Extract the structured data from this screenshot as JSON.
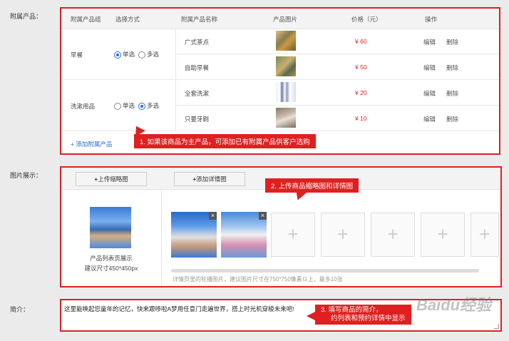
{
  "labels": {
    "accessory": "附属产品：",
    "images": "图片展示：",
    "intro": "简介："
  },
  "accessory_table": {
    "headers": [
      "附属产品组",
      "选择方式",
      "附属产品名称",
      "产品图片",
      "价格（元）",
      "操作"
    ],
    "groups": [
      {
        "name": "早餐",
        "options": [
          {
            "label": "单选",
            "selected": true
          },
          {
            "label": "多选",
            "selected": false
          }
        ],
        "items": [
          {
            "name": "广式茶点",
            "price": "¥ 60",
            "edit": "编辑",
            "delete": "删除"
          },
          {
            "name": "自助早餐",
            "price": "¥ 50",
            "edit": "编辑",
            "delete": "删除"
          }
        ]
      },
      {
        "name": "洗漱用品",
        "options": [
          {
            "label": "单选",
            "selected": false
          },
          {
            "label": "多选",
            "selected": true
          }
        ],
        "items": [
          {
            "name": "全套洗漱",
            "price": "¥ 20",
            "edit": "编辑",
            "delete": "删除"
          },
          {
            "name": "只要牙刷",
            "price": "¥ 10",
            "edit": "编辑",
            "delete": "删除"
          }
        ]
      }
    ],
    "add_link": "+ 添加附属产品"
  },
  "callouts": {
    "c1": "1. 如果该商品为主产品，可添加已有附属产品供客户选购",
    "c2": "2. 上传商品缩略图和详情图",
    "c3_line1": "3. 填写商品的简介，",
    "c3_line2": "约列表和预约详情中显示"
  },
  "images": {
    "upload_thumb": "上传缩略图",
    "add_detail": "添加详情图",
    "thumb_caption1": "产品列表页展示",
    "thumb_caption2": "建议尺寸450*450px",
    "detail_hint": "详情页里的轮播图片，建议图片尺寸在750*750像素以上，最多10张",
    "close": "×",
    "plus": "+"
  },
  "intro": {
    "text": "这里能唤起您童年的记忆，快来跟哆啦A梦用任意门走遍世界，搭上时光机穿梭未来吧!"
  },
  "watermark": "Baidu经验",
  "colors": {
    "accent_red": "#e02020",
    "radio_blue": "#2a6dd1"
  }
}
